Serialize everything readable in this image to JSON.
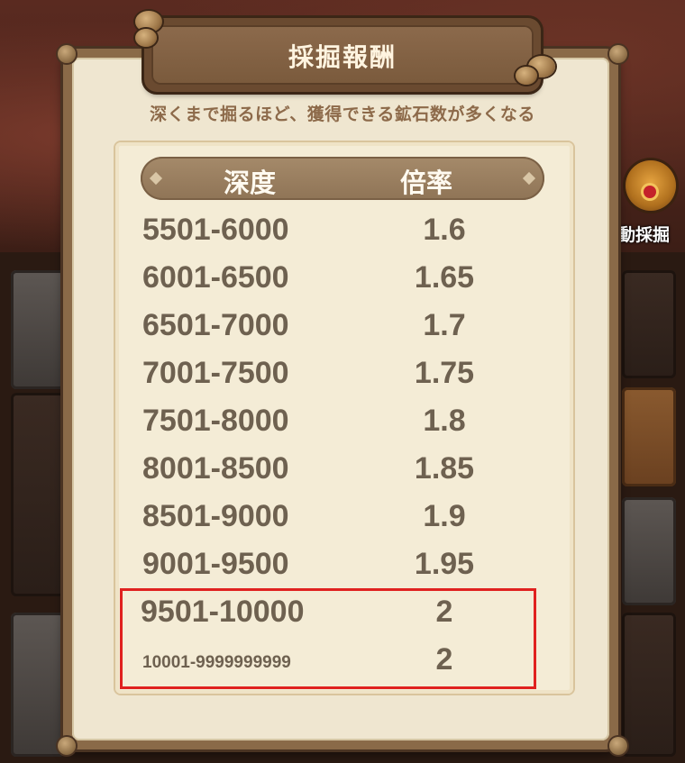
{
  "background": {
    "side_button_label": "動採掘",
    "icon": "auto-dig-icon"
  },
  "dialog": {
    "title": "採掘報酬",
    "subtitle": "深くまで掘るほど、獲得できる鉱石数が多くなる",
    "table": {
      "headers": {
        "depth": "深度",
        "rate": "倍率"
      },
      "rows": [
        {
          "depth": "5501-6000",
          "rate": "1.6"
        },
        {
          "depth": "6001-6500",
          "rate": "1.65"
        },
        {
          "depth": "6501-7000",
          "rate": "1.7"
        },
        {
          "depth": "7001-7500",
          "rate": "1.75"
        },
        {
          "depth": "7501-8000",
          "rate": "1.8"
        },
        {
          "depth": "8001-8500",
          "rate": "1.85"
        },
        {
          "depth": "8501-9000",
          "rate": "1.9"
        },
        {
          "depth": "9001-9500",
          "rate": "1.95"
        },
        {
          "depth": "9501-10000",
          "rate": "2"
        },
        {
          "depth": "10001-9999999999",
          "rate": "2"
        }
      ]
    }
  },
  "colors": {
    "panel_frame": "#8a6a48",
    "panel_bg": "#efe6d0",
    "text": "#6e6150",
    "highlight": "#e0211f"
  }
}
